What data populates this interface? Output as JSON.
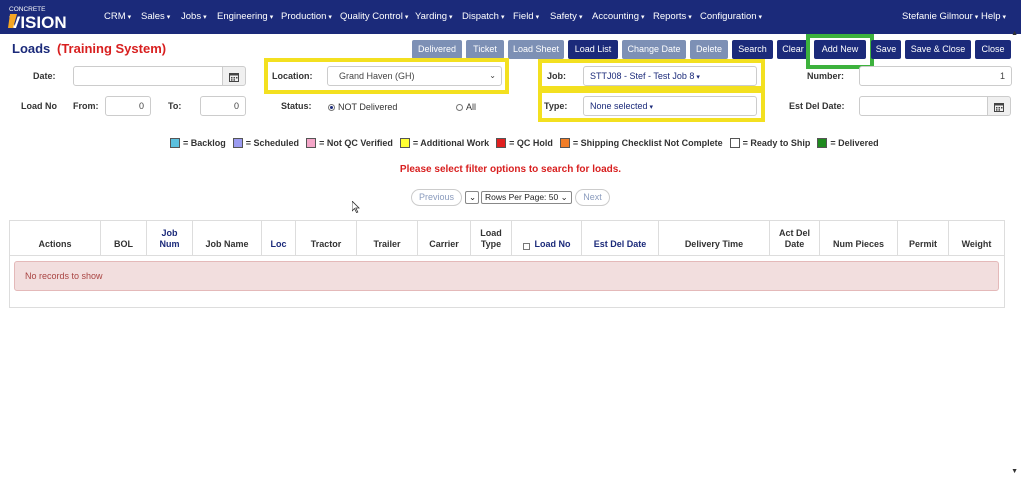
{
  "navbar": {
    "logo_top": "CONCRETE",
    "logo_main": "VISION",
    "menus": [
      "CRM",
      "Sales",
      "Jobs",
      "Engineering",
      "Production",
      "Quality Control",
      "Yarding",
      "Dispatch",
      "Field",
      "Safety",
      "Accounting",
      "Reports",
      "Configuration"
    ],
    "user": "Stefanie Gilmour",
    "help": "Help"
  },
  "page": {
    "title": "Loads",
    "subtitle": "(Training System)"
  },
  "toolbar": {
    "delivered": "Delivered",
    "ticket": "Ticket",
    "load_sheet": "Load Sheet",
    "load_list": "Load List",
    "change_date": "Change Date",
    "delete": "Delete",
    "search": "Search",
    "clear": "Clear",
    "add_new": "Add New",
    "save": "Save",
    "save_close": "Save & Close",
    "close": "Close"
  },
  "form": {
    "date_label": "Date:",
    "date_value": "",
    "location_label": "Location:",
    "location_value": "Grand Haven (GH)",
    "job_label": "Job:",
    "job_value": "STTJ08 - Stef - Test Job 8",
    "number_label": "Number:",
    "number_value": "1",
    "load_no_label": "Load No",
    "from_label": "From:",
    "from_value": "0",
    "to_label": "To:",
    "to_value": "0",
    "status_label": "Status:",
    "status_opt1": "NOT Delivered",
    "status_opt2": "All",
    "type_label": "Type:",
    "type_value": "None selected",
    "est_del_label": "Est Del Date:",
    "est_del_value": ""
  },
  "legend": [
    {
      "label": "= Backlog",
      "color": "#5bc0de"
    },
    {
      "label": "= Scheduled",
      "color": "#9b9bf0"
    },
    {
      "label": "= Not QC Verified",
      "color": "#f4a6c8"
    },
    {
      "label": "= Additional Work",
      "color": "#ffff33"
    },
    {
      "label": "= QC Hold",
      "color": "#e02020"
    },
    {
      "label": "= Shipping Checklist Not Complete",
      "color": "#f07d28"
    },
    {
      "label": "= Ready to Ship",
      "color": "#ffffff"
    },
    {
      "label": "= Delivered",
      "color": "#1f8a1f"
    }
  ],
  "message": "Please select filter options to search for loads.",
  "pager": {
    "previous": "Previous",
    "rows_per_page": "Rows Per Page: 50",
    "next": "Next"
  },
  "table": {
    "columns": {
      "actions": "Actions",
      "bol": "BOL",
      "job_num": "Job Num",
      "job_name": "Job Name",
      "loc": "Loc",
      "tractor": "Tractor",
      "trailer": "Trailer",
      "carrier": "Carrier",
      "load_type": "Load Type",
      "load_no": "Load No",
      "est_del_date": "Est Del Date",
      "delivery_time": "Delivery Time",
      "act_del_date": "Act Del Date",
      "num_pieces": "Num Pieces",
      "permit": "Permit",
      "weight": "Weight"
    },
    "empty": "No records to show"
  },
  "colors": {
    "nav": "#1b2a7a",
    "accent_red": "#d81f1f",
    "highlight_yellow": "#f3e020",
    "highlight_green": "#3db23d"
  }
}
